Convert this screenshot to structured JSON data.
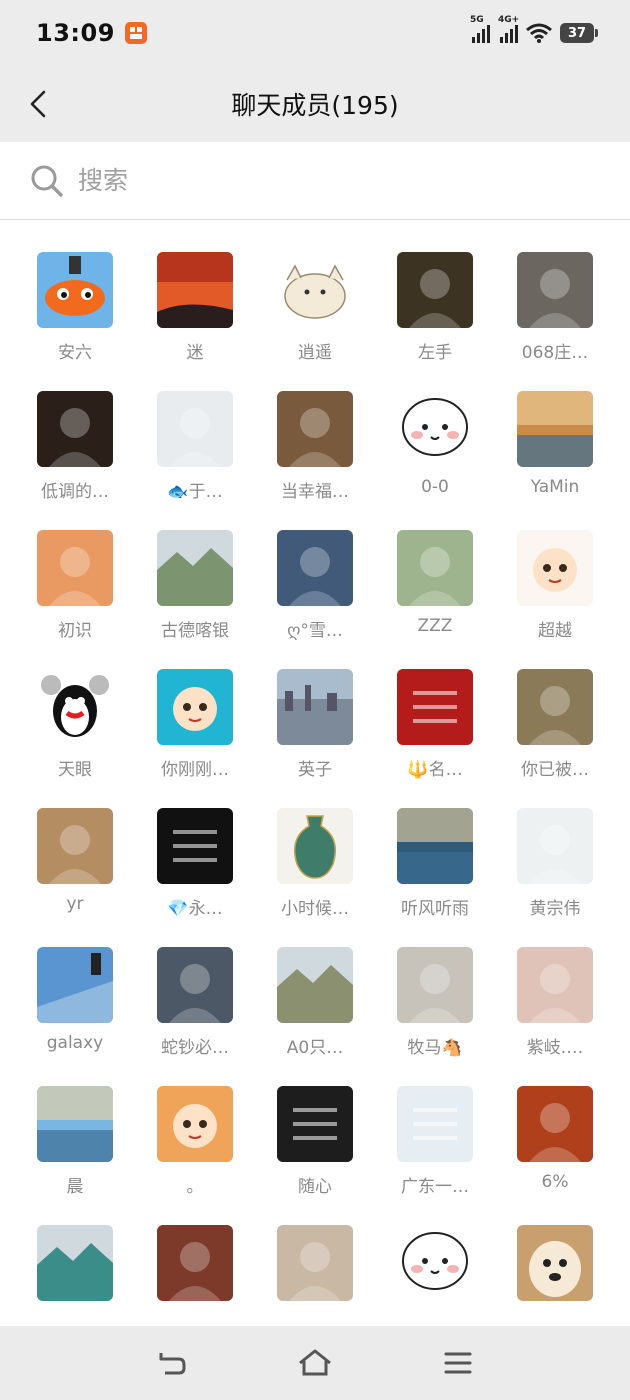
{
  "status": {
    "time": "13:09",
    "app_icon_glyph": "☰",
    "signal1_tag": "5G",
    "signal2_tag": "4G+",
    "battery": "37"
  },
  "header": {
    "title": "聊天成员(195)"
  },
  "search": {
    "placeholder": "搜索"
  },
  "members": [
    {
      "name": "安六",
      "color": "#6fb4e8",
      "icon": "duck-avatar"
    },
    {
      "name": "迷",
      "color": "#d9542c",
      "icon": "sunset-avatar"
    },
    {
      "name": "逍遥",
      "color": "#f3ead8",
      "icon": "cat-avatar"
    },
    {
      "name": "左手",
      "color": "#3d3322",
      "icon": "photo-avatar"
    },
    {
      "name": "068庄…",
      "color": "#6b6660",
      "icon": "photo-avatar"
    },
    {
      "name": "低调的…",
      "color": "#2b2019",
      "icon": "photo-avatar"
    },
    {
      "name": "🐟于…",
      "color": "#e8ecef",
      "icon": "photo-avatar"
    },
    {
      "name": "当幸福…",
      "color": "#7a5a3c",
      "icon": "photo-avatar"
    },
    {
      "name": "0-0",
      "color": "#fdfdfd",
      "icon": "face-avatar"
    },
    {
      "name": "YaMin",
      "color": "#c88b4a",
      "icon": "sea-avatar"
    },
    {
      "name": "初识",
      "color": "#e99a62",
      "icon": "photo-avatar"
    },
    {
      "name": "古德喀银",
      "color": "#7d9470",
      "icon": "landscape-avatar"
    },
    {
      "name": "ღ°雪…",
      "color": "#415a7a",
      "icon": "photo-avatar"
    },
    {
      "name": "ZZZ",
      "color": "#9eb48e",
      "icon": "photo-avatar"
    },
    {
      "name": "超越",
      "color": "#fbf6f1",
      "icon": "cartoon-avatar"
    },
    {
      "name": "天眼",
      "color": "#ffffff",
      "icon": "penguin-avatar"
    },
    {
      "name": "你刚刚…",
      "color": "#21b4d3",
      "icon": "cartoon-avatar"
    },
    {
      "name": "英子",
      "color": "#7c8a99",
      "icon": "city-avatar"
    },
    {
      "name": "🔱名…",
      "color": "#b41c1c",
      "icon": "text-avatar"
    },
    {
      "name": "你已被…",
      "color": "#8b7a58",
      "icon": "photo-avatar"
    },
    {
      "name": "yr",
      "color": "#b58d62",
      "icon": "photo-avatar"
    },
    {
      "name": "💎永…",
      "color": "#111111",
      "icon": "text-avatar"
    },
    {
      "name": "小时候…",
      "color": "#f3f2ec",
      "icon": "vase-avatar"
    },
    {
      "name": "听风听雨",
      "color": "#2e5a7b",
      "icon": "sea-avatar"
    },
    {
      "name": "黄宗伟",
      "color": "#eef1f2",
      "icon": "photo-avatar"
    },
    {
      "name": "galaxy",
      "color": "#5b95d1",
      "icon": "sky-avatar"
    },
    {
      "name": "蛇钞必…",
      "color": "#4d5866",
      "icon": "photo-avatar"
    },
    {
      "name": "A0只…",
      "color": "#8a9070",
      "icon": "landscape-avatar"
    },
    {
      "name": "牧马🐴",
      "color": "#c7c3bb",
      "icon": "photo-avatar"
    },
    {
      "name": "紫岐.…",
      "color": "#e0c3b8",
      "icon": "photo-avatar"
    },
    {
      "name": "晨",
      "color": "#7ab6e2",
      "icon": "sea-avatar"
    },
    {
      "name": "。",
      "color": "#f0a45a",
      "icon": "cartoon-avatar"
    },
    {
      "name": "随心",
      "color": "#1d1d1d",
      "icon": "text-avatar"
    },
    {
      "name": "广东一…",
      "color": "#e7eef3",
      "icon": "text-avatar"
    },
    {
      "name": "6%",
      "color": "#b0401c",
      "icon": "photo-avatar"
    },
    {
      "name": "",
      "color": "#3a8d88",
      "icon": "landscape-avatar"
    },
    {
      "name": "",
      "color": "#7d3a2a",
      "icon": "photo-avatar"
    },
    {
      "name": "",
      "color": "#c9b8a4",
      "icon": "photo-avatar"
    },
    {
      "name": "",
      "color": "#ffffff",
      "icon": "face-avatar"
    },
    {
      "name": "",
      "color": "#d9b48a",
      "icon": "dog-avatar"
    }
  ],
  "nav": {
    "back_icon": "back-nav-icon",
    "home_icon": "home-nav-icon",
    "menu_icon": "menu-nav-icon"
  }
}
